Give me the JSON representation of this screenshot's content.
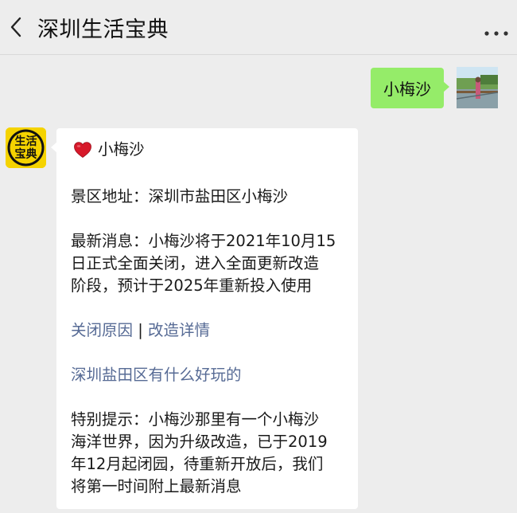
{
  "header": {
    "title": "深圳生活宝典",
    "back_icon": "chevron-left-icon",
    "more_icon": "more-dots-icon"
  },
  "chat": {
    "user_message": "小梅沙",
    "bot_avatar_text": [
      "生活",
      "宝典"
    ],
    "card": {
      "heading": "小梅沙",
      "address": "景区地址：深圳市盐田区小梅沙",
      "news": [
        "最新消息：小梅沙将于2021年10月15",
        "日正式全面关闭，进入全面更新改造",
        "阶段，预计于2025年重新投入使用"
      ],
      "link_reason": "关闭原因",
      "link_separator": "|",
      "link_detail": "改造详情",
      "link_fun": "深圳盐田区有什么好玩的",
      "notice": [
        "特别提示：小梅沙那里有一个小梅沙",
        "海洋世界，因为升级改造，已于2019",
        "年12月起闭园，待重新开放后，我们",
        "将第一时间附上最新消息"
      ]
    }
  },
  "colors": {
    "background": "#ededed",
    "user_bubble": "#95ec69",
    "link": "#576b95",
    "avatar_yellow": "#f5d300"
  }
}
